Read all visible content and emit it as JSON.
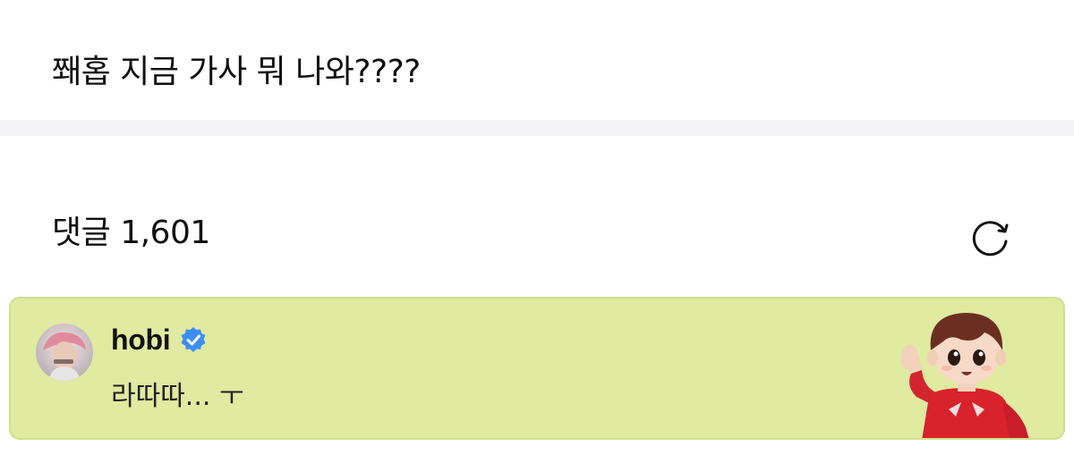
{
  "post": {
    "text": "쫴홉 지금 가사 뭐 나와????"
  },
  "comments": {
    "label": "댓글",
    "count": "1,601",
    "refresh_icon": "refresh-icon"
  },
  "featured_comment": {
    "author": "hobi",
    "verified": true,
    "text": "라따따... ㅜ",
    "avatar_icon": "user-avatar",
    "sticker_icon": "character-sticker",
    "background_color": "#e0eaa0",
    "border_color": "#cfe08a",
    "verified_color": "#3d8df5"
  }
}
